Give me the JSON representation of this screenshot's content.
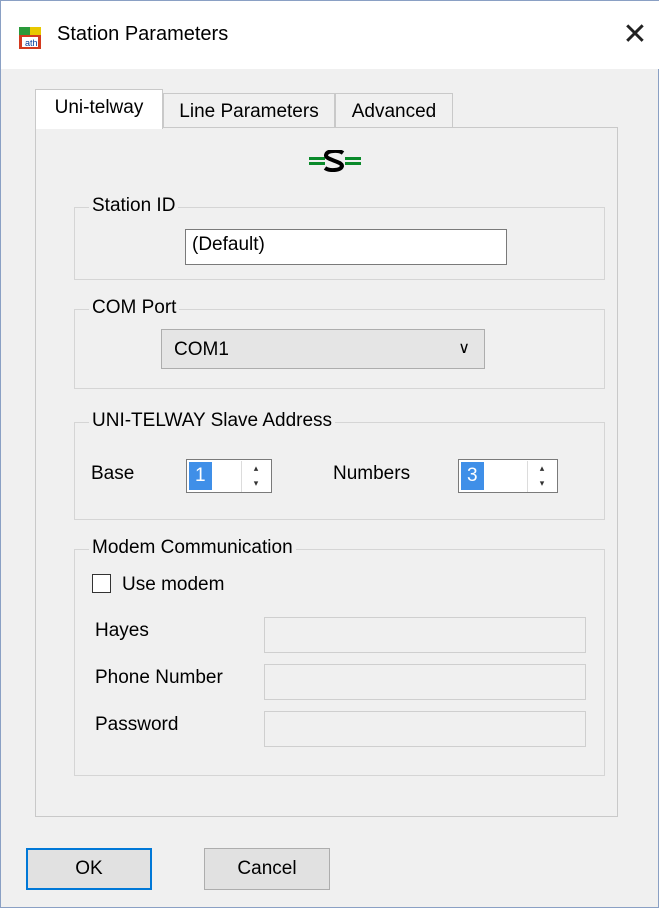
{
  "window": {
    "title": "Station Parameters",
    "close_glyph": "✕",
    "icon": "app-icon"
  },
  "tabs": [
    {
      "label": "Uni-telway",
      "active": true
    },
    {
      "label": "Line Parameters",
      "active": false
    },
    {
      "label": "Advanced",
      "active": false
    }
  ],
  "logo": {
    "icon": "telemecanique-s-icon",
    "color": "#0a8a2a"
  },
  "station_id": {
    "legend": "Station ID",
    "value": "(Default)"
  },
  "com_port": {
    "legend": "COM Port",
    "selected": "COM1"
  },
  "slave_address": {
    "legend": "UNI-TELWAY Slave Address",
    "base_label": "Base",
    "base_value": "1",
    "numbers_label": "Numbers",
    "numbers_value": "3"
  },
  "modem": {
    "legend": "Modem Communication",
    "use_modem_label": "Use modem",
    "use_modem_checked": false,
    "hayes_label": "Hayes",
    "phone_label": "Phone Number",
    "password_label": "Password"
  },
  "buttons": {
    "ok": "OK",
    "cancel": "Cancel"
  },
  "colors": {
    "accent": "#0078d7",
    "selection": "#3f8fe8"
  }
}
